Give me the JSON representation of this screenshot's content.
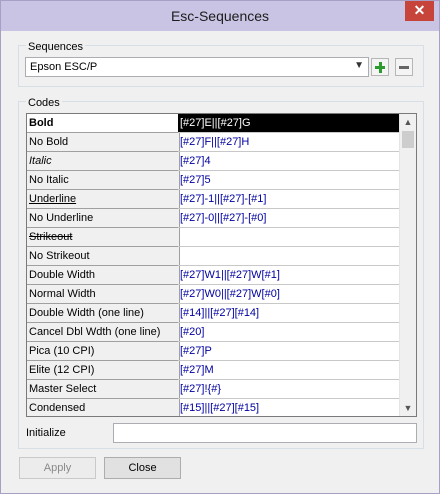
{
  "window": {
    "title": "Esc-Sequences",
    "close_glyph": "✕"
  },
  "sequences": {
    "label": "Sequences",
    "selected": "Epson ESC/P",
    "add_icon": "plus-icon",
    "remove_icon": "minus-icon"
  },
  "codes": {
    "label": "Codes",
    "rows": [
      {
        "name": "Bold",
        "code": "[#27]E||[#27]G",
        "style": "bold",
        "selected": true
      },
      {
        "name": "No Bold",
        "code": "[#27]F||[#27]H",
        "style": ""
      },
      {
        "name": "Italic",
        "code": "[#27]4",
        "style": "italic"
      },
      {
        "name": "No Italic",
        "code": "[#27]5",
        "style": ""
      },
      {
        "name": "Underline",
        "code": "[#27]-1||[#27]-[#1]",
        "style": "underline"
      },
      {
        "name": "No Underline",
        "code": "[#27]-0||[#27]-[#0]",
        "style": ""
      },
      {
        "name": "Strikeout",
        "code": "",
        "style": "strike"
      },
      {
        "name": "No Strikeout",
        "code": "",
        "style": ""
      },
      {
        "name": "Double Width",
        "code": "[#27]W1||[#27]W[#1]",
        "style": ""
      },
      {
        "name": "Normal Width",
        "code": "[#27]W0||[#27]W[#0]",
        "style": ""
      },
      {
        "name": "Double Width (one line)",
        "code": "[#14]||[#27][#14]",
        "style": ""
      },
      {
        "name": "Cancel Dbl Wdth (one line)",
        "code": "[#20]",
        "style": ""
      },
      {
        "name": "Pica (10 CPI)",
        "code": "[#27]P",
        "style": ""
      },
      {
        "name": "Elite (12 CPI)",
        "code": "[#27]M",
        "style": ""
      },
      {
        "name": "Master Select",
        "code": "[#27]!{#}",
        "style": ""
      },
      {
        "name": "Condensed",
        "code": "[#15]||[#27][#15]",
        "style": ""
      }
    ]
  },
  "initialize": {
    "label": "Initialize",
    "value": ""
  },
  "buttons": {
    "apply": "Apply",
    "close": "Close"
  }
}
